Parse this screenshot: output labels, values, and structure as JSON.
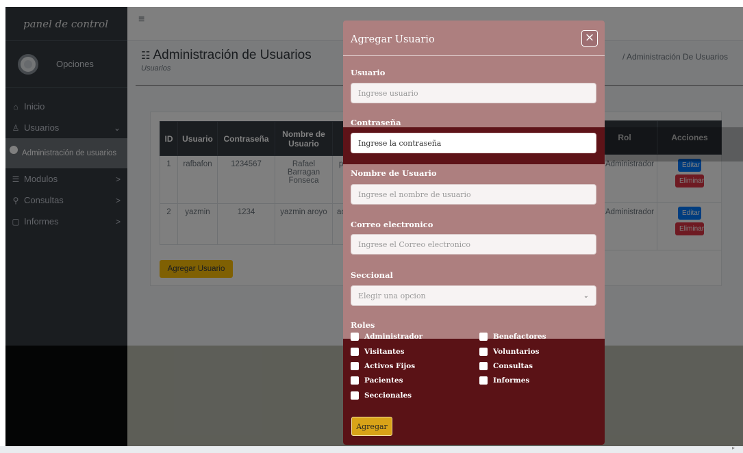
{
  "sidebar": {
    "brand": "panel de control",
    "options_label": "Opciones",
    "items": [
      {
        "icon": "⌂",
        "label": "Inicio",
        "chevron": ""
      },
      {
        "icon": "♙",
        "label": "Usuarios",
        "chevron": "⌄"
      },
      {
        "icon": "●",
        "label": "Administración de usuarios",
        "chevron": ""
      },
      {
        "icon": "☰",
        "label": "Modulos",
        "chevron": ">"
      },
      {
        "icon": "⚲",
        "label": "Consultas",
        "chevron": ">"
      },
      {
        "icon": "▢",
        "label": "Informes",
        "chevron": ">"
      }
    ]
  },
  "header": {
    "title": "Administración de Usuarios",
    "subtitle": "Usuarios",
    "breadcrumb": "/ Administración De Usuarios"
  },
  "table": {
    "columns": [
      "ID",
      "Usuario",
      "Contraseña",
      "Nombre de Usuario",
      "Rol",
      "Acciones"
    ],
    "rows": [
      {
        "id": "1",
        "usuario": "rafbafon",
        "contrasena": "1234567",
        "nombre": "Rafael Barragan Fonseca",
        "rol": "Administrador"
      },
      {
        "id": "2",
        "usuario": "yazmin",
        "contrasena": "1234",
        "nombre": "yazmin aroyo",
        "rol": "Administrador"
      }
    ],
    "edit_label": "Editar",
    "delete_label": "Eliminar",
    "add_button": "Agregar Usuario"
  },
  "modal": {
    "title": "Agregar Usuario",
    "close": "×",
    "fields": {
      "usuario": {
        "label": "Usuario",
        "placeholder": "Ingrese usuario"
      },
      "contrasena": {
        "label": "Contraseña",
        "placeholder": "Ingrese la contraseña"
      },
      "nombre": {
        "label": "Nombre de Usuario",
        "placeholder": "Ingrese el nombre de usuario"
      },
      "correo": {
        "label": "Correo electronico",
        "placeholder": "Ingrese el Correo electronico"
      },
      "seccional": {
        "label": "Seccional",
        "value": "Elegir una opcion"
      }
    },
    "roles_title": "Roles",
    "roles": [
      "Administrador",
      "Benefactores",
      "Visitantes",
      "Voluntarios",
      "Activos Fijos",
      "Consultas",
      "Pacientes",
      "Informes",
      "Seccionales"
    ],
    "submit": "Agregar"
  }
}
